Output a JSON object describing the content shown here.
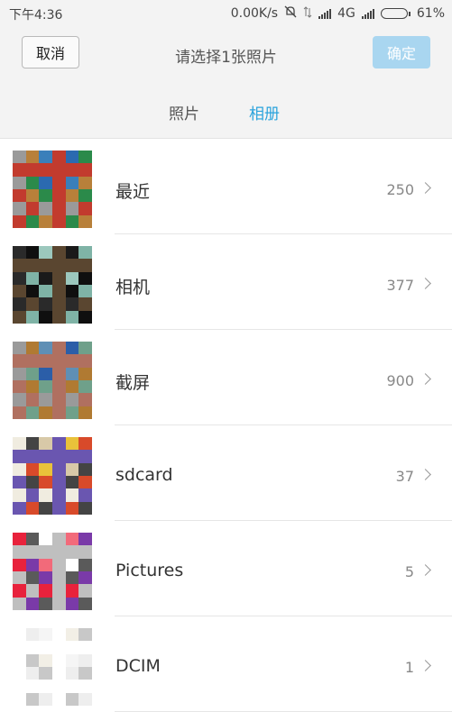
{
  "statusbar": {
    "time": "下午4:36",
    "speed": "0.00K/s",
    "network": "4G",
    "battery": "61%",
    "icons": [
      "mute-bell-icon",
      "data-arrows-icon",
      "signal-icon",
      "signal-icon",
      "battery-icon"
    ]
  },
  "header": {
    "cancel_label": "取消",
    "title": "请选择1张照片",
    "confirm_label": "确定",
    "accent_color": "#2aa3dc",
    "confirm_bg": "#a9d6f0"
  },
  "tabs": [
    {
      "label": "照片",
      "active": false
    },
    {
      "label": "相册",
      "active": true
    }
  ],
  "albums": [
    {
      "name": "最近",
      "count": "250",
      "thumb_colors": [
        "#9a9a9a",
        "#2b8a4a",
        "#2b6ab0",
        "#c23b2e",
        "#3a7fba",
        "#b8803a"
      ]
    },
    {
      "name": "相机",
      "count": "377",
      "thumb_colors": [
        "#2a2a2a",
        "#7fb3a6",
        "#1a1a1a",
        "#5a4630",
        "#9cc8bd",
        "#0f0f0f"
      ]
    },
    {
      "name": "截屏",
      "count": "900",
      "thumb_colors": [
        "#9a9a9a",
        "#6fa08a",
        "#2b5ea8",
        "#b07060",
        "#5f8fb5",
        "#b07a32"
      ]
    },
    {
      "name": "sdcard",
      "count": "37",
      "thumb_colors": [
        "#f0ece0",
        "#d84a2a",
        "#e9c23a",
        "#6a56b0",
        "#d8c9a8",
        "#444444"
      ]
    },
    {
      "name": "Pictures",
      "count": "5",
      "thumb_colors": [
        "#e8223c",
        "#7a3aa8",
        "#f26a7a",
        "#bfbfbf",
        "#ffffff",
        "#5a5a5a"
      ]
    },
    {
      "name": "DCIM",
      "count": "1",
      "thumb_colors": [
        "#ffffff",
        "#c8c8c8",
        "#f2efe6",
        "#ffffff",
        "#f5f5f5",
        "#eeeeee"
      ]
    }
  ]
}
